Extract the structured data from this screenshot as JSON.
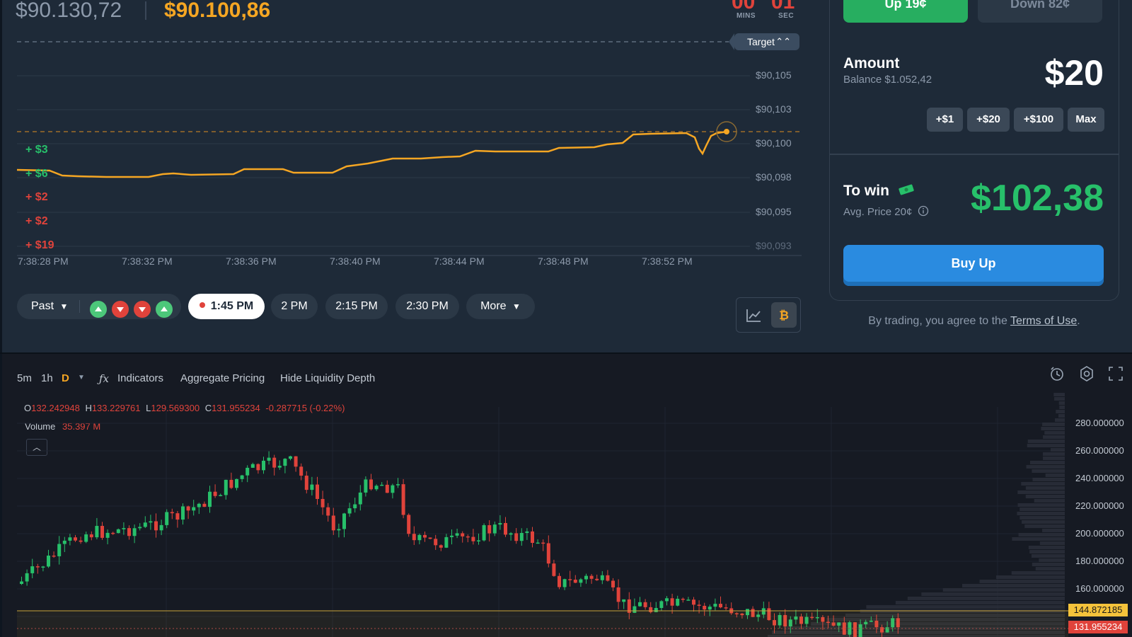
{
  "header": {
    "reference_price": "$90.130,72",
    "current_price": "$90.100,86",
    "countdown_min": "00",
    "countdown_sec": "01",
    "mins_label": "MINS",
    "sec_label": "SEC"
  },
  "price_chart": {
    "target_label": "Target",
    "y_labels": [
      "$90,105",
      "$90,103",
      "$90,100",
      "$90,098",
      "$90,095",
      "$90,093"
    ],
    "x_labels": [
      "7:38:28 PM",
      "7:38:32 PM",
      "7:38:36 PM",
      "7:38:40 PM",
      "7:38:44 PM",
      "7:38:48 PM",
      "7:38:52 PM"
    ],
    "trades": [
      {
        "text": "+ $3",
        "color": "#27c06a"
      },
      {
        "text": "+ $6",
        "color": "#27c06a"
      },
      {
        "text": "+ $2",
        "color": "#e0433b"
      },
      {
        "text": "+ $2",
        "color": "#e0433b"
      },
      {
        "text": "+ $19",
        "color": "#e0433b"
      }
    ]
  },
  "controls": {
    "past_label": "Past",
    "markers": [
      "up",
      "down",
      "down",
      "up"
    ],
    "times": [
      "1:45 PM",
      "2 PM",
      "2:15 PM",
      "2:30 PM"
    ],
    "more_label": "More"
  },
  "order_panel": {
    "up_label": "Up 19¢",
    "down_label": "Down 82¢",
    "amount_title": "Amount",
    "balance": "Balance $1.052,42",
    "amount_value": "$20",
    "chips": [
      "+$1",
      "+$20",
      "+$100",
      "Max"
    ],
    "to_win_title": "To win",
    "avg_price": "Avg. Price 20¢",
    "to_win_value": "$102,38",
    "buy_label": "Buy Up",
    "terms_prefix": "By trading, you agree to the ",
    "terms_link": "Terms of Use",
    "terms_suffix": "."
  },
  "candle_toolbar": {
    "intervals": [
      "5m",
      "1h",
      "D"
    ],
    "indicators_label": "Indicators",
    "aggregate_label": "Aggregate Pricing",
    "liquidity_label": "Hide Liquidity Depth"
  },
  "ohlc": {
    "o_label": "O",
    "o": "132.242948",
    "h_label": "H",
    "h": "133.229761",
    "l_label": "L",
    "l": "129.569300",
    "c_label": "C",
    "c": "131.955234",
    "change": "-0.287715 (-0.22%)",
    "volume_label": "Volume",
    "volume": "35.397 M"
  },
  "candle_axis": {
    "labels": [
      "280.000000",
      "260.000000",
      "240.000000",
      "220.000000",
      "200.000000",
      "180.000000",
      "160.000000"
    ],
    "gold_badge": "144.872185",
    "red_badge": "131.955234"
  },
  "colors": {
    "up": "#27c06a",
    "down": "#e0433b",
    "accent": "#f5a623",
    "primary": "#2a8be0"
  }
}
